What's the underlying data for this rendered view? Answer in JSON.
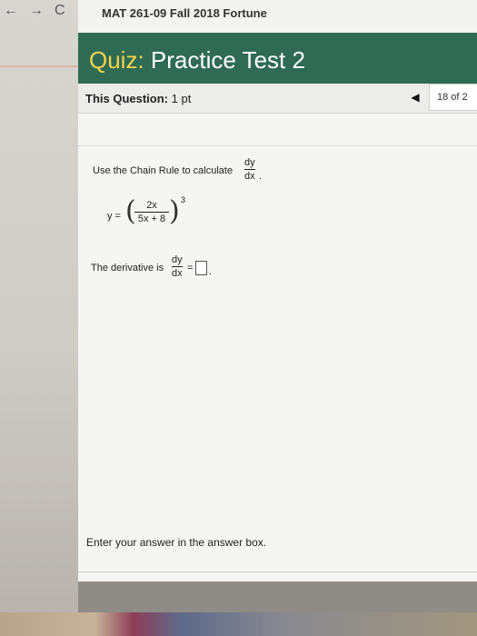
{
  "browser": {
    "back_icon": "←",
    "forward_icon": "→",
    "reload_icon": "C"
  },
  "header": {
    "course_title": "MAT 261-09 Fall 2018 Fortune"
  },
  "quiz": {
    "title_prefix": "Quiz:",
    "title_rest": " Practice Test 2"
  },
  "question_info": {
    "label": "This Question:",
    "points": "1 pt",
    "prev_icon": "◀",
    "counter": "18 of 2"
  },
  "question": {
    "instruction": "Use the Chain Rule to calculate",
    "dy": "dy",
    "dx": "dx",
    "period": ".",
    "y_eq": "y =",
    "numerator": "2x",
    "denominator": "5x + 8",
    "exponent": "3",
    "left_paren": "(",
    "right_paren": ")",
    "derivative_label": "The derivative is",
    "equals": "=",
    "hint": "Enter your answer in the answer box."
  }
}
